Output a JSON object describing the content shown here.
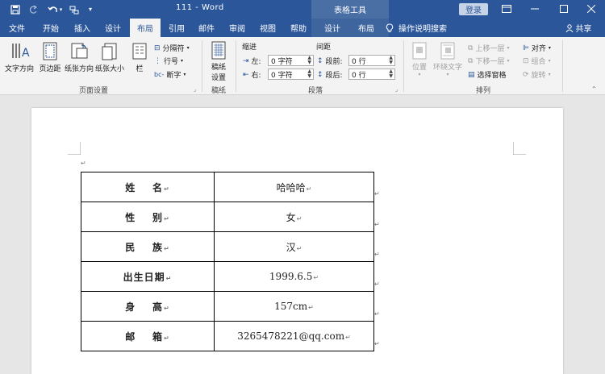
{
  "titlebar": {
    "doc_title": "111 - Word",
    "context_title": "表格工具",
    "login": "登录",
    "quick_access": [
      "save-icon",
      "redo-icon",
      "undo-icon",
      "format-painter-icon",
      "customize-icon"
    ]
  },
  "tabs": [
    {
      "label": "文件"
    },
    {
      "label": "开始"
    },
    {
      "label": "插入"
    },
    {
      "label": "设计"
    },
    {
      "label": "布局"
    },
    {
      "label": "引用"
    },
    {
      "label": "邮件"
    },
    {
      "label": "审阅"
    },
    {
      "label": "视图"
    },
    {
      "label": "帮助"
    },
    {
      "label": "设计"
    },
    {
      "label": "布局"
    }
  ],
  "tell_me": "操作说明搜索",
  "share": "共享",
  "ribbon": {
    "page_setup": {
      "text_direction": "文字方向",
      "margins": "页边距",
      "orientation": "纸张方向",
      "size": "纸张大小",
      "columns": "栏",
      "breaks": "分隔符",
      "line_numbers": "行号",
      "hyphenation": "断字",
      "group_label": "页面设置"
    },
    "draft": {
      "button_line1": "稿纸",
      "button_line2": "设置",
      "group_label": "稿纸"
    },
    "paragraph": {
      "indent_header": "缩进",
      "spacing_header": "间距",
      "left_label": "左:",
      "right_label": "右:",
      "before_label": "段前:",
      "after_label": "段后:",
      "left_value": "0 字符",
      "right_value": "0 字符",
      "before_value": "0 行",
      "after_value": "0 行",
      "group_label": "段落"
    },
    "arrange": {
      "position": "位置",
      "wrap_text": "环绕文字",
      "bring_forward": "上移一层",
      "send_backward": "下移一层",
      "selection_pane": "选择窗格",
      "align": "对齐",
      "group": "组合",
      "rotate": "旋转",
      "group_label": "排列"
    }
  },
  "table": {
    "rows": [
      {
        "label": "姓    名",
        "value": "哈哈哈"
      },
      {
        "label": "性    别",
        "value": "女"
      },
      {
        "label": "民    族",
        "value": "汉"
      },
      {
        "label": "出生日期",
        "value": "1999.6.5"
      },
      {
        "label": "身    高",
        "value": "157cm"
      },
      {
        "label": "邮    箱",
        "value": "3265478221@qq.com"
      }
    ],
    "paragraph_mark": "↵"
  }
}
